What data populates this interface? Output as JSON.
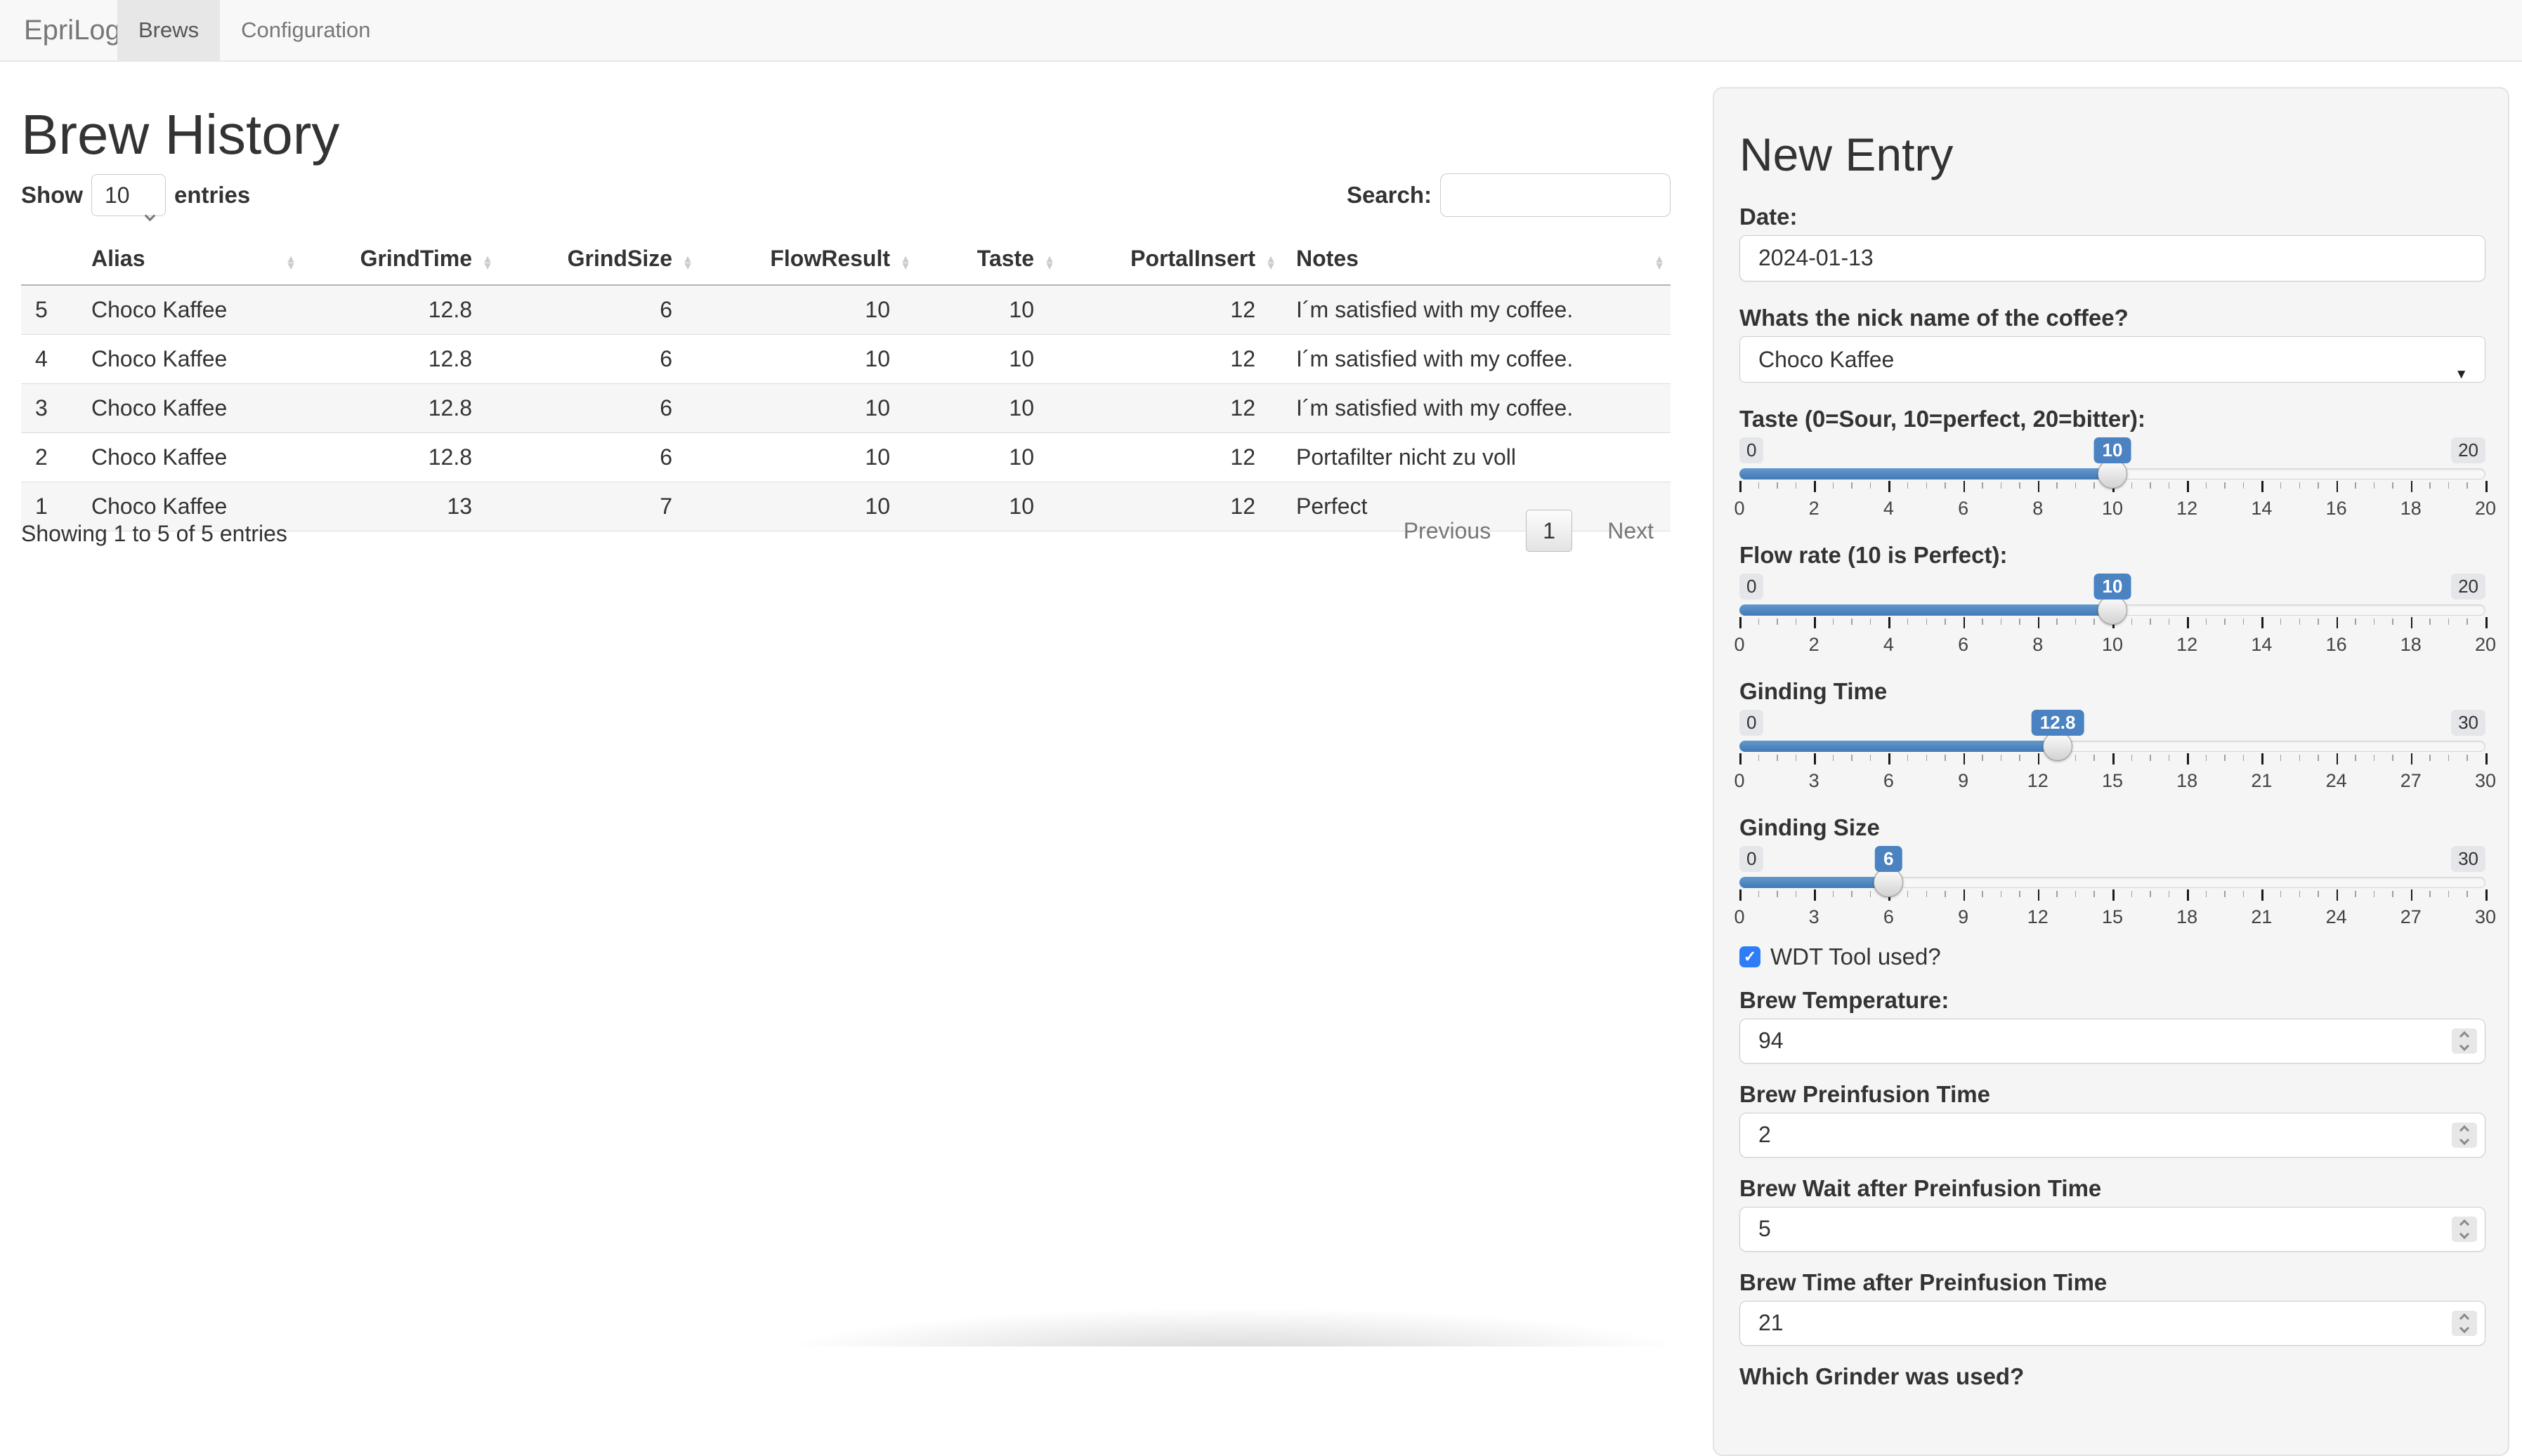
{
  "navbar": {
    "brand": "EpriLog",
    "tabs": [
      {
        "label": "Brews",
        "active": true
      },
      {
        "label": "Configuration",
        "active": false
      }
    ]
  },
  "history": {
    "title": "Brew History",
    "length_control": {
      "show_label": "Show",
      "selected": "10",
      "entries_label": "entries"
    },
    "search_label": "Search:",
    "search_value": "",
    "table": {
      "columns": [
        {
          "label": "",
          "align": "left"
        },
        {
          "label": "Alias",
          "align": "left"
        },
        {
          "label": "GrindTime",
          "align": "right"
        },
        {
          "label": "GrindSize",
          "align": "right"
        },
        {
          "label": "FlowResult",
          "align": "right"
        },
        {
          "label": "Taste",
          "align": "right"
        },
        {
          "label": "PortalInsert",
          "align": "right"
        },
        {
          "label": "Notes",
          "align": "left"
        }
      ],
      "rows": [
        [
          "5",
          "Choco Kaffee",
          "12.8",
          "6",
          "10",
          "10",
          "12",
          "I´m satisfied with my coffee."
        ],
        [
          "4",
          "Choco Kaffee",
          "12.8",
          "6",
          "10",
          "10",
          "12",
          "I´m satisfied with my coffee."
        ],
        [
          "3",
          "Choco Kaffee",
          "12.8",
          "6",
          "10",
          "10",
          "12",
          "I´m satisfied with my coffee."
        ],
        [
          "2",
          "Choco Kaffee",
          "12.8",
          "6",
          "10",
          "10",
          "12",
          "Portafilter nicht zu voll"
        ],
        [
          "1",
          "Choco Kaffee",
          "13",
          "7",
          "10",
          "10",
          "12",
          "Perfect"
        ]
      ]
    },
    "info": "Showing 1 to 5 of 5 entries",
    "pagination": {
      "previous": "Previous",
      "page": "1",
      "next": "Next"
    }
  },
  "form": {
    "title": "New Entry",
    "date": {
      "label": "Date:",
      "value": "2024-01-13"
    },
    "nickname": {
      "label": "Whats the nick name of the coffee?",
      "value": "Choco Kaffee"
    },
    "sliders": [
      {
        "id": "taste",
        "label": "Taste (0=Sour, 10=perfect, 20=bitter):",
        "min": 0,
        "max": 20,
        "value": 10,
        "grid": [
          0,
          2,
          4,
          6,
          8,
          10,
          12,
          14,
          16,
          18,
          20
        ]
      },
      {
        "id": "flow-rate",
        "label": "Flow rate (10 is Perfect):",
        "min": 0,
        "max": 20,
        "value": 10,
        "grid": [
          0,
          2,
          4,
          6,
          8,
          10,
          12,
          14,
          16,
          18,
          20
        ]
      },
      {
        "id": "grinding-time",
        "label": "Ginding Time",
        "min": 0,
        "max": 30,
        "value": 12.8,
        "grid": [
          0,
          3,
          6,
          9,
          12,
          15,
          18,
          21,
          24,
          27,
          30
        ]
      },
      {
        "id": "grinding-size",
        "label": "Ginding Size",
        "min": 0,
        "max": 30,
        "value": 6,
        "grid": [
          0,
          3,
          6,
          9,
          12,
          15,
          18,
          21,
          24,
          27,
          30
        ]
      }
    ],
    "wdt": {
      "label": "WDT Tool used?",
      "checked": true,
      "check_glyph": "✓"
    },
    "numbers": [
      {
        "id": "brew-temperature",
        "label": "Brew Temperature:",
        "value": "94"
      },
      {
        "id": "brew-preinfusion-time",
        "label": "Brew Preinfusion Time",
        "value": "2"
      },
      {
        "id": "brew-wait-after-preinfusion-time",
        "label": "Brew Wait after Preinfusion Time",
        "value": "5"
      },
      {
        "id": "brew-time-after-preinfusion-time",
        "label": "Brew Time after Preinfusion Time",
        "value": "21"
      }
    ],
    "grinder": {
      "label": "Which Grinder was used?"
    }
  },
  "colors": {
    "accent": "#4a82c2",
    "checkbox_blue": "#2e7df6",
    "stripe": "#f6f6f6"
  }
}
